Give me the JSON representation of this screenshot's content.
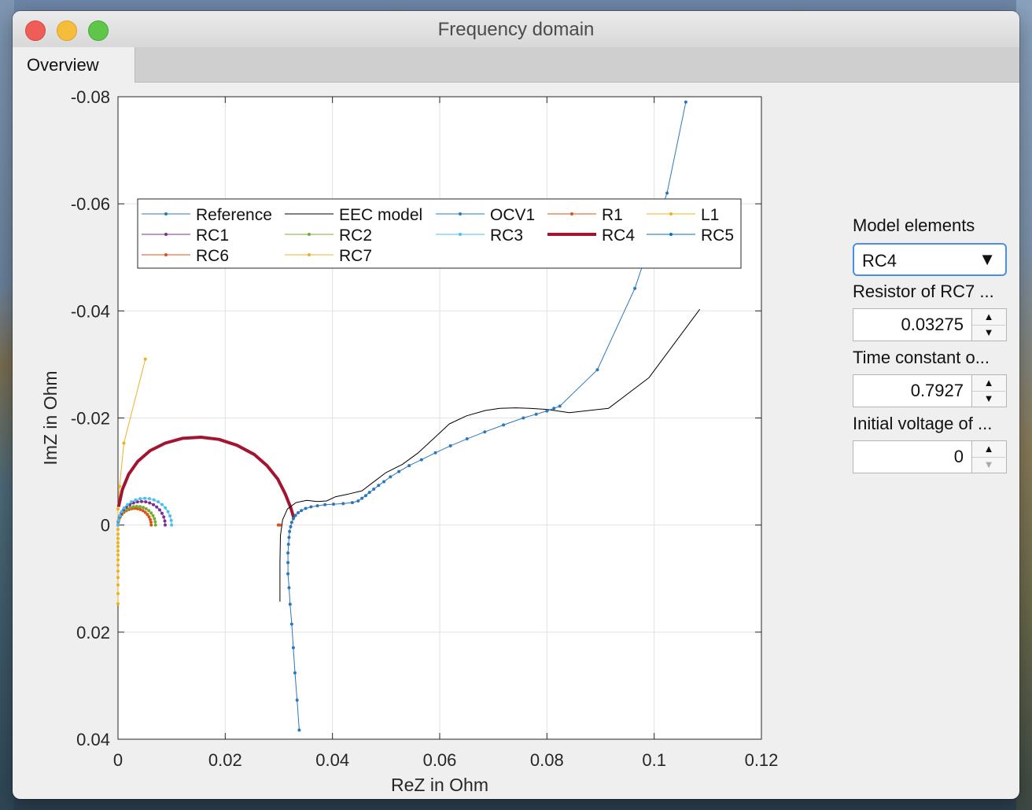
{
  "window": {
    "title": "Frequency domain"
  },
  "tabs": [
    {
      "label": "Overview"
    }
  ],
  "side_panel": {
    "model_elements_label": "Model elements",
    "model_elements_value": "RC4",
    "resistor_label": "Resistor of RC7 ...",
    "resistor_value": "0.03275",
    "time_constant_label": "Time constant o...",
    "time_constant_value": "0.7927",
    "initial_voltage_label": "Initial voltage of ...",
    "initial_voltage_value": "0"
  },
  "chart_data": {
    "type": "line",
    "xlabel": "ReZ  in  Ohm",
    "ylabel": "ImZ  in  Ohm",
    "xlim": [
      0,
      0.12
    ],
    "ylim": [
      -0.08,
      0.04
    ],
    "y_reversed": true,
    "grid": true,
    "legend_position": "top-left inside, 5 columns",
    "xticks": [
      "0",
      "0.02",
      "0.04",
      "0.06",
      "0.08",
      "0.1",
      "0.12"
    ],
    "yticks": [
      "-0.08",
      "-0.06",
      "-0.04",
      "-0.02",
      "0",
      "0.02",
      "0.04"
    ],
    "series": [
      {
        "name": "Reference",
        "color": "#2b77bd",
        "marker": true,
        "width": 1,
        "x": [
          0.0338,
          0.0334,
          0.033,
          0.0327,
          0.0324,
          0.0321,
          0.0319,
          0.0317,
          0.0317,
          0.0317,
          0.0318,
          0.0319,
          0.032,
          0.0322,
          0.0324,
          0.0327,
          0.0331,
          0.0336,
          0.0342,
          0.035,
          0.036,
          0.0372,
          0.0386,
          0.0402,
          0.042,
          0.0437,
          0.0448,
          0.0455,
          0.0462,
          0.0469,
          0.0477,
          0.0486,
          0.0496,
          0.0508,
          0.0524,
          0.0543,
          0.0566,
          0.0592,
          0.062,
          0.0651,
          0.0684,
          0.0719,
          0.0756,
          0.078,
          0.08,
          0.0813,
          0.0824,
          0.0894,
          0.0964,
          0.099,
          0.1024,
          0.1059
        ],
        "y": [
          0.0383,
          0.0327,
          0.0276,
          0.0229,
          0.0185,
          0.0148,
          0.0117,
          0.0091,
          0.007,
          0.0052,
          0.0036,
          0.0023,
          0.0012,
          0.0003,
          -0.0005,
          -0.0012,
          -0.0018,
          -0.0023,
          -0.0027,
          -0.0031,
          -0.0034,
          -0.0036,
          -0.0038,
          -0.0039,
          -0.004,
          -0.0042,
          -0.0045,
          -0.005,
          -0.0055,
          -0.0061,
          -0.0067,
          -0.0074,
          -0.0081,
          -0.009,
          -0.01,
          -0.0111,
          -0.0122,
          -0.0135,
          -0.0148,
          -0.0161,
          -0.0174,
          -0.0187,
          -0.02,
          -0.0207,
          -0.0213,
          -0.0218,
          -0.0222,
          -0.029,
          -0.0442,
          -0.052,
          -0.062,
          -0.079
        ]
      },
      {
        "name": "EEC model",
        "color": "#000000",
        "marker": false,
        "width": 1,
        "x": [
          0.0302,
          0.0302,
          0.0303,
          0.0307,
          0.0316,
          0.0332,
          0.0352,
          0.0372,
          0.0389,
          0.0406,
          0.043,
          0.0455,
          0.0476,
          0.05,
          0.053,
          0.056,
          0.0588,
          0.0618,
          0.065,
          0.0685,
          0.0712,
          0.0742,
          0.0768,
          0.08,
          0.0842,
          0.0915,
          0.099,
          0.1085
        ],
        "y": [
          0.0143,
          0.007,
          0.002,
          -0.001,
          -0.003,
          -0.0042,
          -0.0046,
          -0.0044,
          -0.0045,
          -0.0053,
          -0.0058,
          -0.0064,
          -0.008,
          -0.0098,
          -0.0113,
          -0.0135,
          -0.0161,
          -0.0189,
          -0.0204,
          -0.0214,
          -0.0218,
          -0.0219,
          -0.0218,
          -0.0216,
          -0.021,
          -0.0218,
          -0.0275,
          -0.0403
        ]
      },
      {
        "name": "OCV1",
        "color": "#2b77bd",
        "marker": true,
        "width": 1,
        "x": [],
        "y": []
      },
      {
        "name": "R1",
        "color": "#d95319",
        "marker": true,
        "width": 1,
        "x": [
          0.0299,
          0.0302
        ],
        "y": [
          0,
          0
        ]
      },
      {
        "name": "L1",
        "color": "#edb120",
        "marker": true,
        "width": 1,
        "x": [
          0,
          0,
          0,
          0,
          0,
          0,
          0,
          0,
          0,
          0,
          0,
          0,
          0,
          0,
          0,
          0,
          0.0003,
          0.0011,
          0.0051
        ],
        "y": [
          0.0147,
          0.0128,
          0.0112,
          0.0098,
          0.0086,
          0.0075,
          0.0065,
          0.0056,
          0.0048,
          0.004,
          0.0033,
          0.0025,
          0.0017,
          0.0008,
          0,
          -0.003,
          -0.0072,
          -0.0153,
          -0.031
        ]
      },
      {
        "name": "RC1",
        "color": "#7e2f8e",
        "marker": true,
        "width": 1,
        "semicircle": {
          "r0": 0,
          "r1": 0.0088
        }
      },
      {
        "name": "RC2",
        "color": "#77ac30",
        "marker": true,
        "width": 1,
        "semicircle": {
          "r0": 0,
          "r1": 0.007
        }
      },
      {
        "name": "RC3",
        "color": "#4dbeee",
        "marker": true,
        "width": 1,
        "semicircle": {
          "r0": 0,
          "r1": 0.01
        }
      },
      {
        "name": "RC4",
        "color": "#a2142f",
        "marker": false,
        "width": 4,
        "x": [
          0.0328,
          0.0322,
          0.0312,
          0.0298,
          0.0278,
          0.0254,
          0.0222,
          0.0188,
          0.0155,
          0.012,
          0.0088,
          0.006,
          0.0037,
          0.002,
          0.0008,
          0.0001
        ],
        "y": [
          -0.0013,
          -0.0033,
          -0.0058,
          -0.0086,
          -0.0111,
          -0.0132,
          -0.0149,
          -0.016,
          -0.0164,
          -0.0162,
          -0.0153,
          -0.0139,
          -0.0119,
          -0.0095,
          -0.0066,
          -0.0034
        ]
      },
      {
        "name": "RC5",
        "color": "#0072bd",
        "marker": true,
        "width": 1,
        "x": [],
        "y": []
      },
      {
        "name": "RC6",
        "color": "#d95319",
        "marker": true,
        "width": 1,
        "semicircle": {
          "r0": 0,
          "r1": 0.0062
        }
      },
      {
        "name": "RC7",
        "color": "#edb120",
        "marker": true,
        "width": 1,
        "x": [],
        "y": []
      }
    ]
  }
}
